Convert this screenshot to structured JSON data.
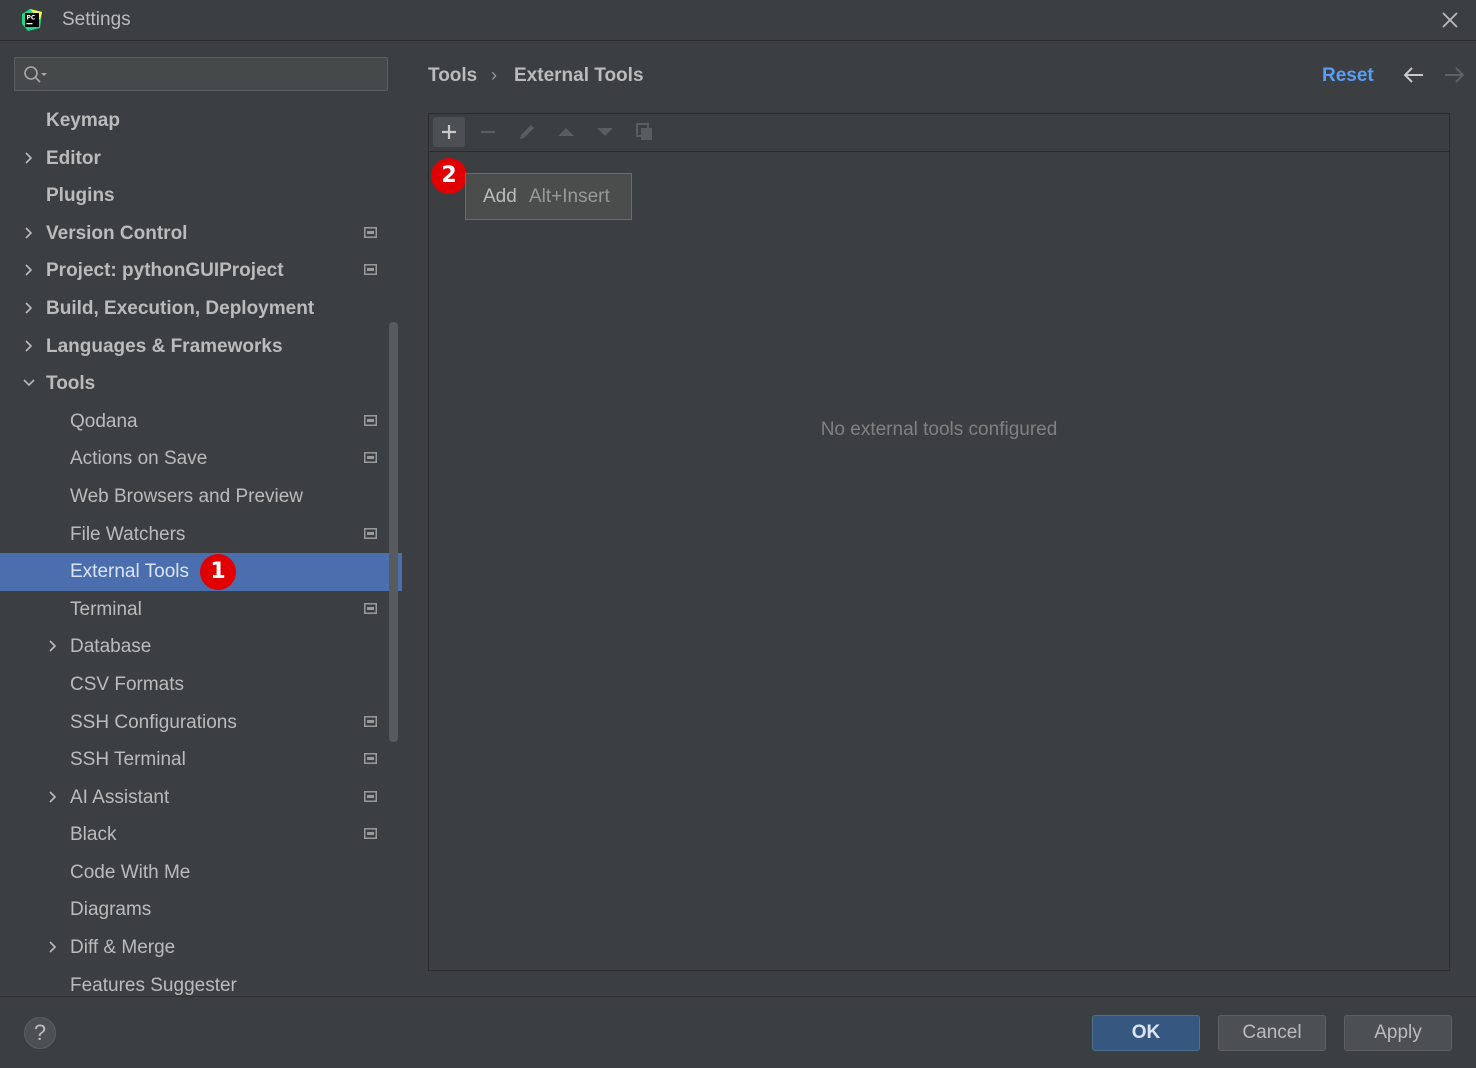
{
  "window": {
    "title": "Settings"
  },
  "search": {
    "placeholder": ""
  },
  "sidebar": {
    "items": [
      {
        "label": "Keymap",
        "level": 0,
        "expandable": false,
        "expanded": false,
        "project": false,
        "selected": false
      },
      {
        "label": "Editor",
        "level": 0,
        "expandable": true,
        "expanded": false,
        "project": false,
        "selected": false
      },
      {
        "label": "Plugins",
        "level": 0,
        "expandable": false,
        "expanded": false,
        "project": false,
        "selected": false
      },
      {
        "label": "Version Control",
        "level": 0,
        "expandable": true,
        "expanded": false,
        "project": true,
        "selected": false
      },
      {
        "label": "Project: pythonGUIProject",
        "level": 0,
        "expandable": true,
        "expanded": false,
        "project": true,
        "selected": false
      },
      {
        "label": "Build, Execution, Deployment",
        "level": 0,
        "expandable": true,
        "expanded": false,
        "project": false,
        "selected": false
      },
      {
        "label": "Languages & Frameworks",
        "level": 0,
        "expandable": true,
        "expanded": false,
        "project": false,
        "selected": false
      },
      {
        "label": "Tools",
        "level": 0,
        "expandable": true,
        "expanded": true,
        "project": false,
        "selected": false
      },
      {
        "label": "Qodana",
        "level": 1,
        "expandable": false,
        "expanded": false,
        "project": true,
        "selected": false
      },
      {
        "label": "Actions on Save",
        "level": 1,
        "expandable": false,
        "expanded": false,
        "project": true,
        "selected": false
      },
      {
        "label": "Web Browsers and Preview",
        "level": 1,
        "expandable": false,
        "expanded": false,
        "project": false,
        "selected": false
      },
      {
        "label": "File Watchers",
        "level": 1,
        "expandable": false,
        "expanded": false,
        "project": true,
        "selected": false
      },
      {
        "label": "External Tools",
        "level": 1,
        "expandable": false,
        "expanded": false,
        "project": false,
        "selected": true,
        "badge": "1"
      },
      {
        "label": "Terminal",
        "level": 1,
        "expandable": false,
        "expanded": false,
        "project": true,
        "selected": false
      },
      {
        "label": "Database",
        "level": 1,
        "expandable": true,
        "expanded": false,
        "project": false,
        "selected": false
      },
      {
        "label": "CSV Formats",
        "level": 1,
        "expandable": false,
        "expanded": false,
        "project": false,
        "selected": false
      },
      {
        "label": "SSH Configurations",
        "level": 1,
        "expandable": false,
        "expanded": false,
        "project": true,
        "selected": false
      },
      {
        "label": "SSH Terminal",
        "level": 1,
        "expandable": false,
        "expanded": false,
        "project": true,
        "selected": false
      },
      {
        "label": "AI Assistant",
        "level": 1,
        "expandable": true,
        "expanded": false,
        "project": true,
        "selected": false
      },
      {
        "label": "Black",
        "level": 1,
        "expandable": false,
        "expanded": false,
        "project": true,
        "selected": false
      },
      {
        "label": "Code With Me",
        "level": 1,
        "expandable": false,
        "expanded": false,
        "project": false,
        "selected": false
      },
      {
        "label": "Diagrams",
        "level": 1,
        "expandable": false,
        "expanded": false,
        "project": false,
        "selected": false
      },
      {
        "label": "Diff & Merge",
        "level": 1,
        "expandable": true,
        "expanded": false,
        "project": false,
        "selected": false
      },
      {
        "label": "Features Suggester",
        "level": 1,
        "expandable": false,
        "expanded": false,
        "project": false,
        "selected": false
      }
    ]
  },
  "header": {
    "breadcrumb": [
      "Tools",
      "External Tools"
    ],
    "separator": "›",
    "reset_label": "Reset"
  },
  "toolbar": {
    "buttons": [
      {
        "name": "add",
        "icon": "plus-icon",
        "enabled": true
      },
      {
        "name": "remove",
        "icon": "minus-icon",
        "enabled": false
      },
      {
        "name": "edit",
        "icon": "pencil-icon",
        "enabled": false
      },
      {
        "name": "move-up",
        "icon": "arrow-up-icon",
        "enabled": false
      },
      {
        "name": "move-down",
        "icon": "arrow-down-icon",
        "enabled": false
      },
      {
        "name": "copy",
        "icon": "copy-icon",
        "enabled": false
      }
    ]
  },
  "tooltip": {
    "label": "Add",
    "shortcut": "Alt+Insert",
    "badge": "2"
  },
  "content": {
    "empty_text": "No external tools configured"
  },
  "footer": {
    "help_label": "?",
    "ok_label": "OK",
    "cancel_label": "Cancel",
    "apply_label": "Apply"
  },
  "colors": {
    "background": "#3c3f41",
    "selection": "#4b6eaf",
    "accent": "#589df6",
    "ok_button": "#365880",
    "badge": "#e10000"
  }
}
